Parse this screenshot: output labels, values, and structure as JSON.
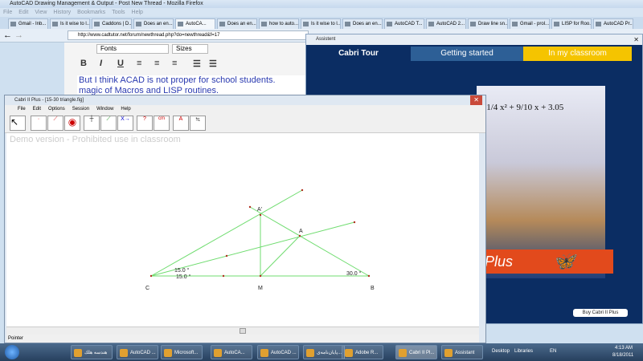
{
  "firefox": {
    "title": "AutoCAD Drawing Management & Output - Post New Thread - Mozilla Firefox",
    "menu": [
      "File",
      "Edit",
      "View",
      "History",
      "Bookmarks",
      "Tools",
      "Help"
    ],
    "tabs": [
      "Gmail - Inb...",
      "Is it wise to l...",
      "Caddons | D...",
      "Does an en...",
      "AutoCA...",
      "Does an en...",
      "how to auto...",
      "Is it wise to l...",
      "Does an en...",
      "AutoCAD T...",
      "AutoCAD 2...",
      "Draw line sn...",
      "Gmail - prol...",
      "LISP for Roo...",
      "AutoCAD Pr..."
    ],
    "active_tab": 4,
    "url": "http://www.cadtutor.net/forum/newthread.php?do=newthread&f=17"
  },
  "editor": {
    "font_select": "Fonts",
    "size_select": "Sizes",
    "bold": "B",
    "italic": "I",
    "underline": "U",
    "text_line1": "But I think ACAD is not proper for school students.",
    "text_line2": "magic of Macros and LISP routines."
  },
  "assistant": {
    "title": "Assistent",
    "tabs": [
      "Cabri Tour",
      "Getting started",
      "In my classroom"
    ],
    "formula": "−1/4 x² + 9/10 x + 3.05",
    "banner": "Plus",
    "buy_button": "Buy Cabri II Plus"
  },
  "cabri": {
    "title": "Cabri II Plus - [15-30 triangle.fig]",
    "menu": [
      "File",
      "Edit",
      "Options",
      "Session",
      "Window",
      "Help"
    ],
    "demo_notice": "Demo version - Prohibited use in classroom",
    "labels": {
      "C": "C",
      "M": "M",
      "B": "B",
      "A": "A",
      "A_prime": "A'"
    },
    "angles": {
      "upper": "15.0 °",
      "lower": "15.0 °",
      "at_B": "30.0 °"
    },
    "status": "Pointer"
  },
  "taskbar": {
    "items": [
      "هندسه هلك",
      "AutoCAD ...",
      "Microsoft...",
      "AutoCA...",
      "AutoCAD ...",
      "پایان‌نامه‌ی...",
      "Adobe R...",
      "Cabri II Pl...",
      "Assistant"
    ],
    "active": 7,
    "desktop": "Desktop",
    "libraries": "Libraries",
    "lang": "EN",
    "time": "4:13 AM",
    "date": "8/18/2011"
  },
  "colors": {
    "line": "#6fdc6f",
    "point": "#b03020",
    "asst_bg": "#0b2d63",
    "yellow": "#f5c400"
  }
}
